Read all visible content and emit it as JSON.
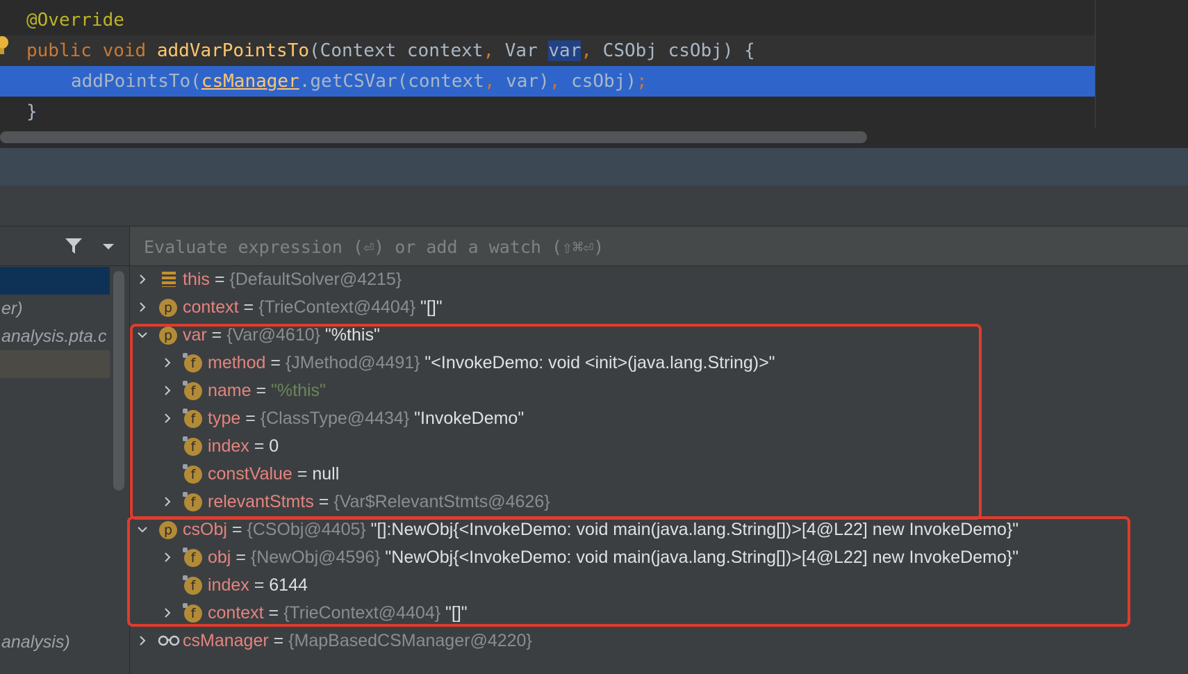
{
  "editor": {
    "lines": [
      {
        "annotation": "@Override"
      },
      {
        "kw_public": "public",
        "kw_void": "void",
        "method": "addVarPointsTo",
        "p1": "(Context context",
        "comma1": ",",
        "p2": " Var ",
        "sel_var": "var",
        "comma2": ",",
        "p3": " CSObj csObj) {"
      },
      {
        "call": "addPointsTo(",
        "field": "csManager",
        "rest1": ".getCSVar(context",
        "comma1": ",",
        "rest2": " var)",
        "comma2": ",",
        "rest3": " csObj)",
        "semi": ";"
      },
      {
        "brace": "}"
      }
    ]
  },
  "debugger": {
    "eval_placeholder": "Evaluate expression (⏎) or add a watch (⇧⌘⏎)",
    "frames": [
      {
        "label": ""
      },
      {
        "label": "er)"
      },
      {
        "label": "analysis.pta.c"
      },
      {
        "label": ""
      },
      {
        "label": "analysis)"
      }
    ],
    "variables": [
      {
        "badge": "",
        "name": "this",
        "eq": " = ",
        "type": "{DefaultSolver@4215}",
        "value": ""
      },
      {
        "badge": "p",
        "name": "context",
        "eq": " = ",
        "type": "{TrieContext@4404}",
        "value": " \"[]\""
      },
      {
        "badge": "p",
        "name": "var",
        "eq": " = ",
        "type": "{Var@4610}",
        "value": " \"%this\""
      },
      {
        "badge": "f",
        "name": "method",
        "eq": " = ",
        "type": "{JMethod@4491}",
        "value": " \"<InvokeDemo: void <init>(java.lang.String)>\""
      },
      {
        "badge": "f",
        "name": "name",
        "eq": " = ",
        "type": "",
        "value": "\"%this\""
      },
      {
        "badge": "f",
        "name": "type",
        "eq": " = ",
        "type": "{ClassType@4434}",
        "value": " \"InvokeDemo\""
      },
      {
        "badge": "f",
        "name": "index",
        "eq": " = ",
        "type": "",
        "value": "0"
      },
      {
        "badge": "f",
        "name": "constValue",
        "eq": " = ",
        "type": "",
        "value": "null"
      },
      {
        "badge": "f",
        "name": "relevantStmts",
        "eq": " = ",
        "type": "{Var$RelevantStmts@4626}",
        "value": ""
      },
      {
        "badge": "p",
        "name": "csObj",
        "eq": " = ",
        "type": "{CSObj@4405}",
        "value": " \"[]:NewObj{<InvokeDemo: void main(java.lang.String[])>[4@L22] new InvokeDemo}\""
      },
      {
        "badge": "f",
        "name": "obj",
        "eq": " = ",
        "type": "{NewObj@4596}",
        "value": " \"NewObj{<InvokeDemo: void main(java.lang.String[])>[4@L22] new InvokeDemo}\""
      },
      {
        "badge": "f",
        "name": "index",
        "eq": " = ",
        "type": "",
        "value": "6144"
      },
      {
        "badge": "f",
        "name": "context",
        "eq": " = ",
        "type": "{TrieContext@4404}",
        "value": " \"[]\""
      },
      {
        "badge": "",
        "name": "csManager",
        "eq": " = ",
        "type": "{MapBasedCSManager@4220}",
        "value": ""
      }
    ]
  },
  "colors": {
    "highlight_box": "#e03c2c",
    "current_line": "#2f65ca",
    "badge": "#b38b36"
  },
  "icons": [
    "filter-icon",
    "dropdown-arrow-icon",
    "chevron-right-icon",
    "chevron-down-icon",
    "stack-icon",
    "watch-glasses-icon",
    "lightbulb-icon"
  ]
}
